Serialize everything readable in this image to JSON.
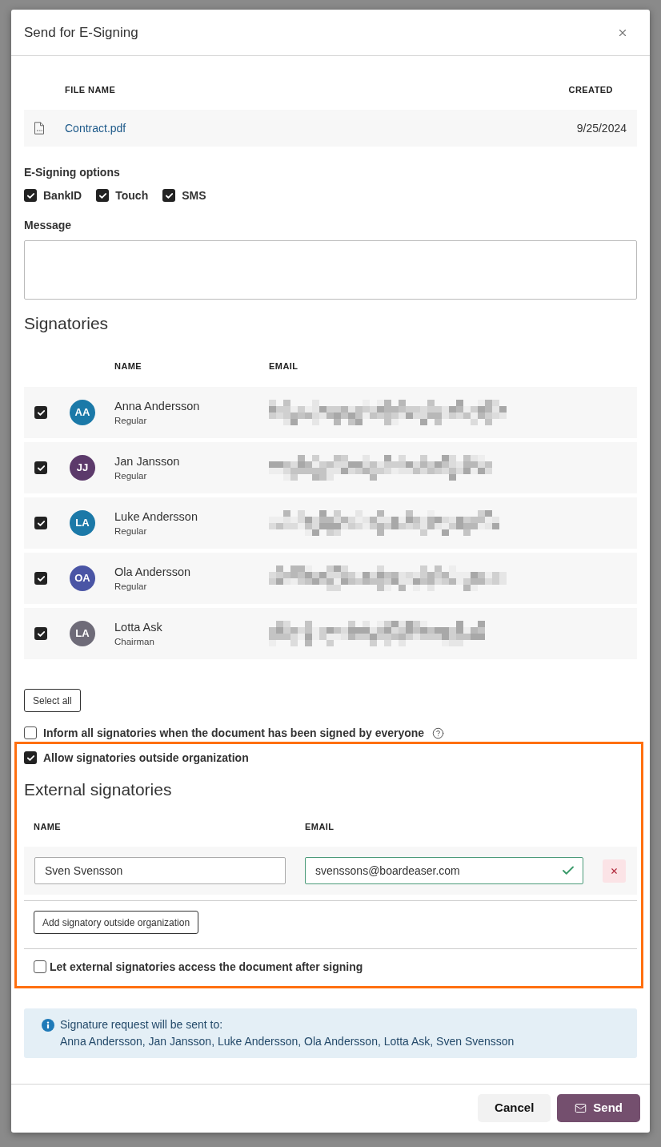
{
  "dialog": {
    "title": "Send for E-Signing"
  },
  "files": {
    "columns": [
      "FILE NAME",
      "CREATED"
    ],
    "rows": [
      {
        "name": "Contract.pdf",
        "created": "9/25/2024"
      }
    ]
  },
  "esigning_options": {
    "label": "E-Signing options",
    "options": [
      {
        "label": "BankID",
        "checked": true
      },
      {
        "label": "Touch",
        "checked": true
      },
      {
        "label": "SMS",
        "checked": true
      }
    ]
  },
  "message": {
    "label": "Message"
  },
  "signatories": {
    "title": "Signatories",
    "columns": [
      "NAME",
      "EMAIL"
    ],
    "rows": [
      {
        "checked": true,
        "initials": "AA",
        "color": "#1b79a8",
        "name": "Anna Andersson",
        "role": "Regular"
      },
      {
        "checked": true,
        "initials": "JJ",
        "color": "#5c3a6b",
        "name": "Jan Jansson",
        "role": "Regular"
      },
      {
        "checked": true,
        "initials": "LA",
        "color": "#1b79a8",
        "name": "Luke Andersson",
        "role": "Regular"
      },
      {
        "checked": true,
        "initials": "OA",
        "color": "#4a55a5",
        "name": "Ola Andersson",
        "role": "Regular"
      },
      {
        "checked": true,
        "initials": "LA",
        "color": "#6e6b78",
        "name": "Lotta Ask",
        "role": "Chairman"
      }
    ]
  },
  "select_all": "Select all",
  "inform_everyone": {
    "label": "Inform all signatories when the document has been signed by everyone",
    "checked": false
  },
  "allow_outside": {
    "label": "Allow signatories outside organization",
    "checked": true
  },
  "external": {
    "title": "External signatories",
    "columns": [
      "NAME",
      "EMAIL"
    ],
    "rows": [
      {
        "name": "Sven Svensson",
        "email": "svenssons@boardeaser.com",
        "valid": true
      }
    ],
    "add_button": "Add signatory outside organization",
    "access_after": {
      "label": "Let external signatories access the document after signing",
      "checked": false
    }
  },
  "notice": {
    "title": "Signature request will be sent to:",
    "recipients": "Anna Andersson, Jan Jansson, Luke Andersson, Ola Andersson, Lotta Ask, Sven Svensson"
  },
  "footer": {
    "buttons": [
      {
        "label": "Cancel",
        "kind": "secondary"
      },
      {
        "label": "Send",
        "kind": "primary"
      }
    ]
  }
}
